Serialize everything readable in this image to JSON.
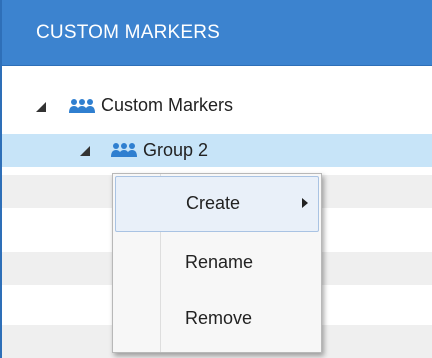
{
  "panel": {
    "title": "CUSTOM MARKERS",
    "accent_color": "#3c83cf"
  },
  "tree": {
    "root": {
      "label": "Custom Markers",
      "icon": "group-icon",
      "expanded": true
    },
    "child": {
      "label": "Group 2",
      "icon": "group-icon",
      "expanded": true,
      "selected": true
    }
  },
  "context_menu": {
    "items": [
      {
        "label": "Create",
        "has_submenu": true,
        "hovered": true
      },
      {
        "label": "Rename",
        "has_submenu": false
      },
      {
        "label": "Remove",
        "has_submenu": false
      }
    ]
  }
}
